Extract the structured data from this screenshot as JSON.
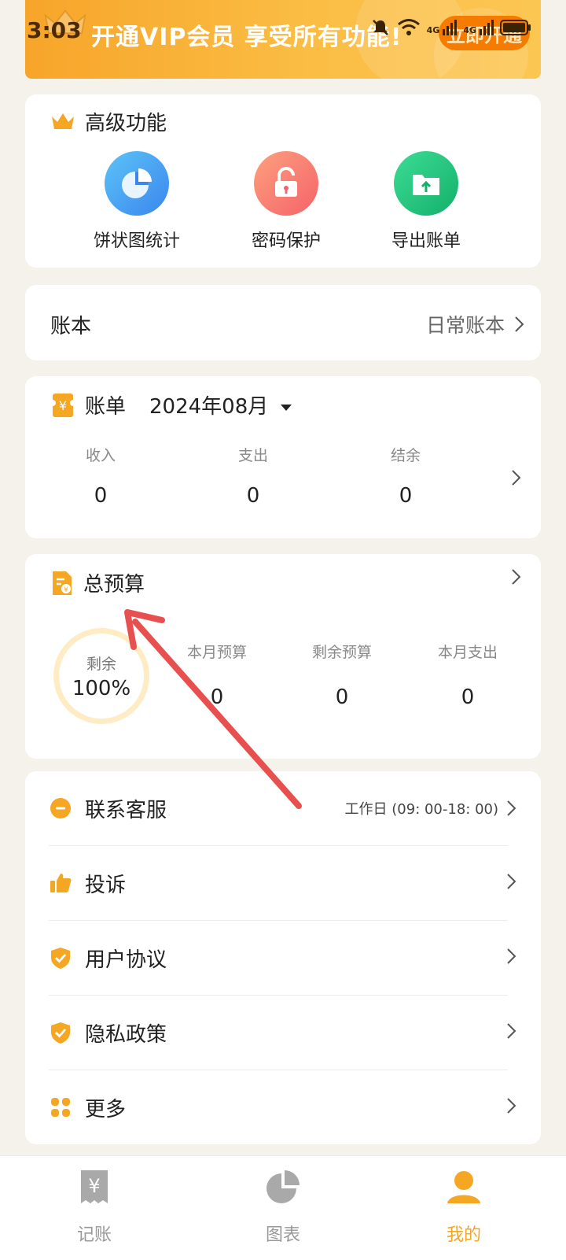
{
  "status_bar": {
    "time": "3:03",
    "network_1": "4G",
    "network_2": "4G"
  },
  "vip_banner": {
    "text": "开通VIP会员 享受所有功能!",
    "button": "立即开通"
  },
  "advanced": {
    "title": "高级功能",
    "features": [
      {
        "label": "饼状图统计",
        "icon": "pie-chart-icon",
        "color": "#4a9ff5"
      },
      {
        "label": "密码保护",
        "icon": "unlock-icon",
        "color": "#f77a66"
      },
      {
        "label": "导出账单",
        "icon": "export-folder-icon",
        "color": "#25c07a"
      }
    ]
  },
  "account_book": {
    "label": "账本",
    "value": "日常账本"
  },
  "bill": {
    "title": "账单",
    "month": "2024年08月",
    "stats": [
      {
        "label": "收入",
        "value": "0"
      },
      {
        "label": "支出",
        "value": "0"
      },
      {
        "label": "结余",
        "value": "0"
      }
    ]
  },
  "budget": {
    "title": "总预算",
    "ring_label": "剩余",
    "ring_value": "100%",
    "ring_fraction": 1.0,
    "stats": [
      {
        "label": "本月预算",
        "value": "0"
      },
      {
        "label": "剩余预算",
        "value": "0"
      },
      {
        "label": "本月支出",
        "value": "0"
      }
    ]
  },
  "menu": [
    {
      "label": "联系客服",
      "extra": "工作日 (09: 00-18: 00)",
      "icon": "chat-bubble-icon"
    },
    {
      "label": "投诉",
      "extra": "",
      "icon": "thumbs-up-icon"
    },
    {
      "label": "用户协议",
      "extra": "",
      "icon": "shield-check-icon"
    },
    {
      "label": "隐私政策",
      "extra": "",
      "icon": "shield-check-icon"
    },
    {
      "label": "更多",
      "extra": "",
      "icon": "grid-icon"
    }
  ],
  "bottom_nav": [
    {
      "label": "记账",
      "icon": "receipt-icon",
      "active": false
    },
    {
      "label": "图表",
      "icon": "pie-chart-icon",
      "active": false
    },
    {
      "label": "我的",
      "icon": "profile-icon",
      "active": true
    }
  ],
  "colors": {
    "accent": "#f5a623",
    "background": "#f5f2ec",
    "annotation": "#e8504f"
  }
}
